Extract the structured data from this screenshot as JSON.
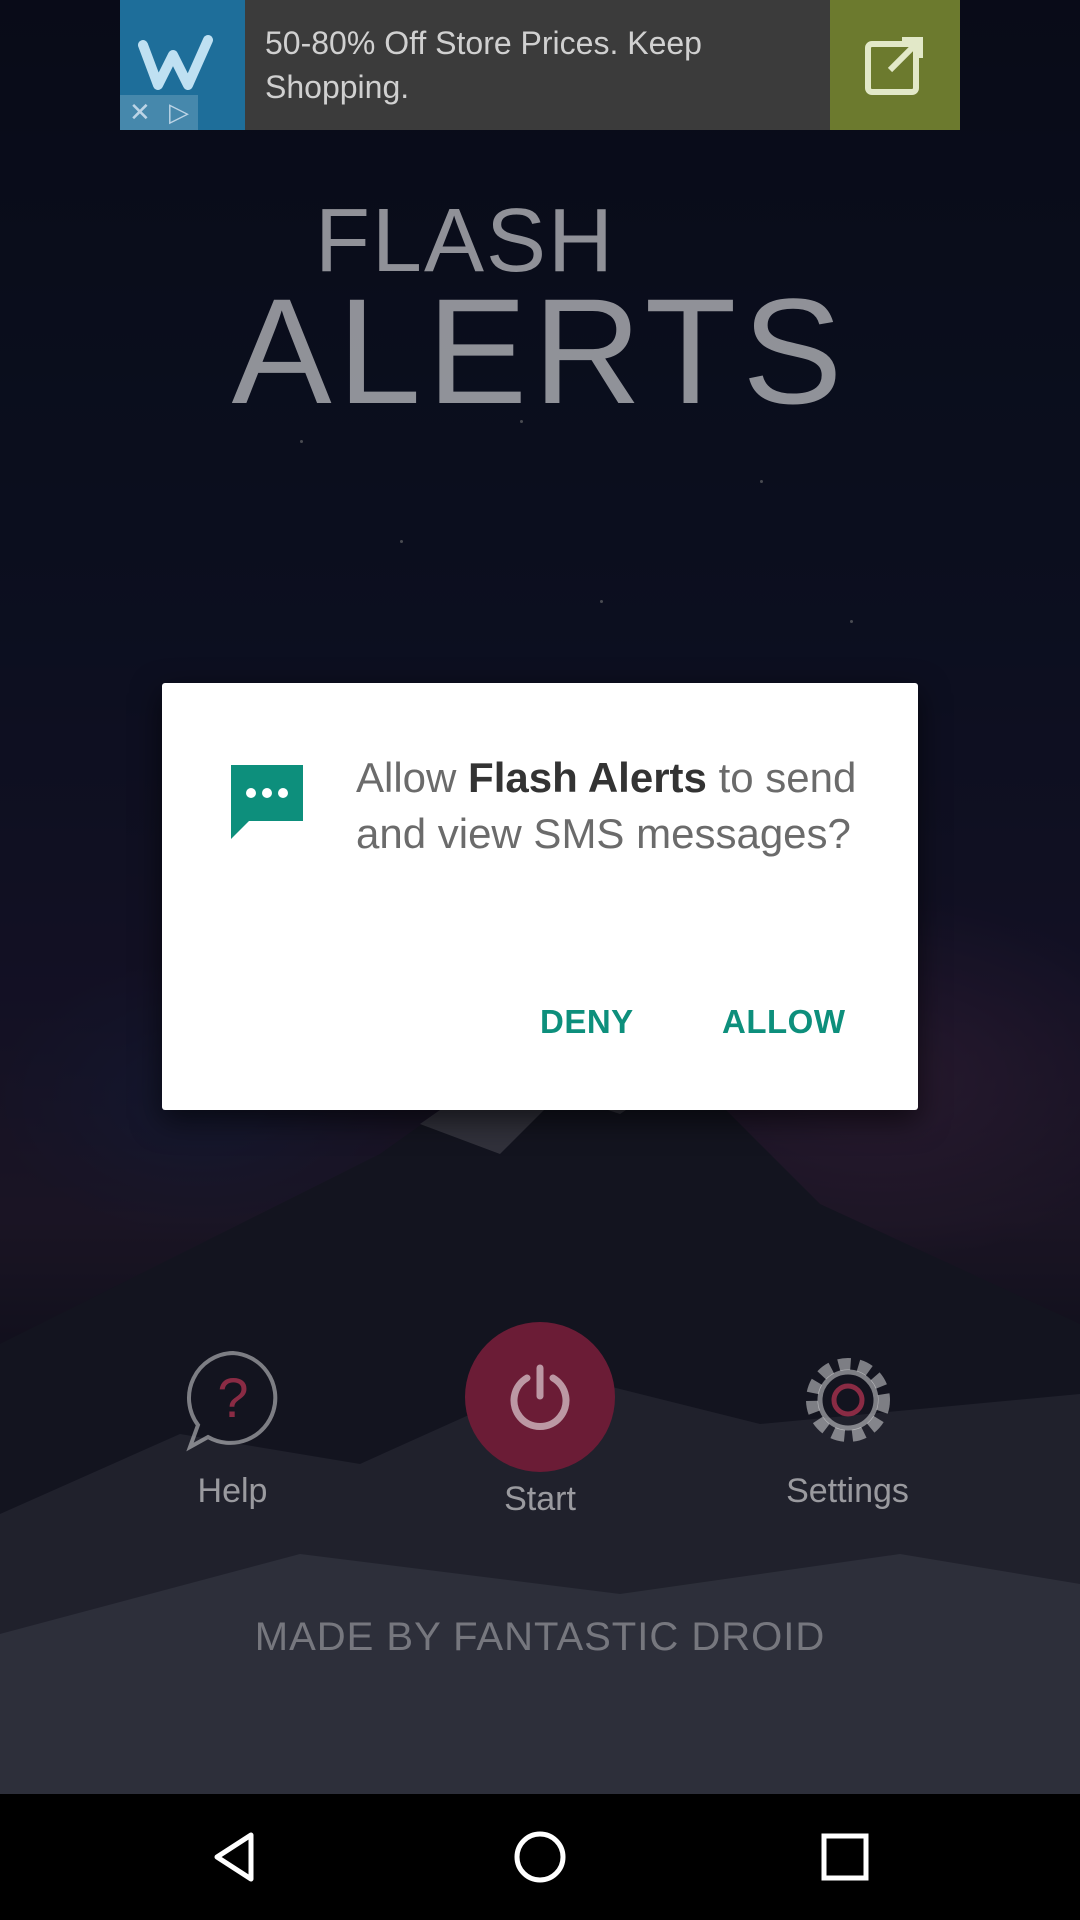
{
  "ad": {
    "text": "50-80% Off Store Prices. Keep Shopping.",
    "logo_icon": "wish-logo-icon",
    "open_icon": "open-external-icon",
    "close_icon": "close-icon",
    "adchoices_icon": "adchoices-icon"
  },
  "app": {
    "title_small": "FLASH",
    "title_large": "ALERTS",
    "credit": "MADE BY FANTASTIC DROID"
  },
  "controls": {
    "help_label": "Help",
    "start_label": "Start",
    "settings_label": "Settings"
  },
  "dialog": {
    "icon": "sms-icon",
    "message_prefix": "Allow ",
    "app_name": "Flash Alerts",
    "message_suffix": " to send and view SMS messages?",
    "deny_label": "DENY",
    "allow_label": "ALLOW",
    "accent_color": "#0d8f7c"
  },
  "navbar": {
    "back_icon": "back-icon",
    "home_icon": "home-icon",
    "recents_icon": "recents-icon"
  }
}
